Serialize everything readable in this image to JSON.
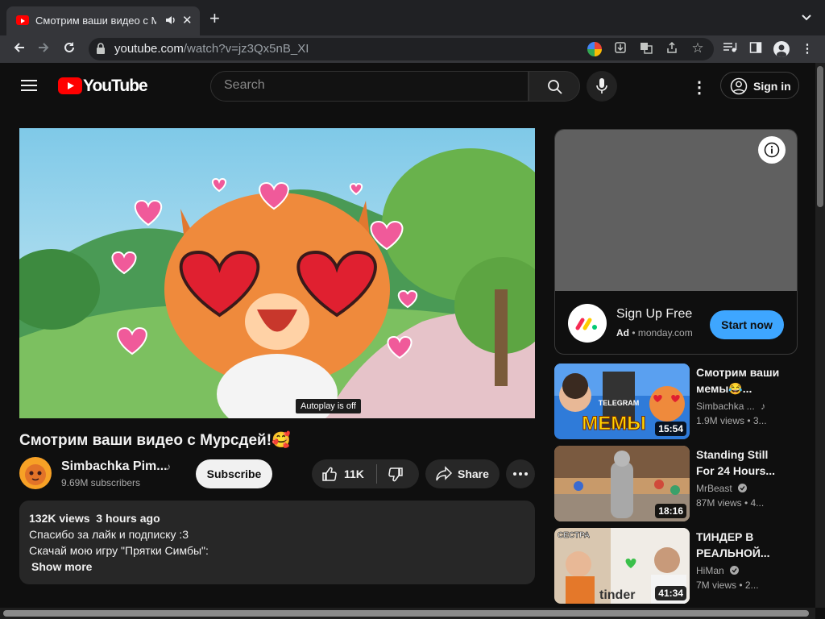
{
  "browser": {
    "tab_title": "Смотрим ваши видео с М",
    "url_host": "youtube.com",
    "url_path": "/watch?v=jz3Qx5nB_XI"
  },
  "header": {
    "logo_text": "YouTube",
    "search_placeholder": "Search",
    "signin_label": "Sign in"
  },
  "player": {
    "tooltip": "Autoplay is off"
  },
  "video": {
    "title": "Смотрим ваши видео с Мурсдей!🥰",
    "channel": "Simbachka Pim...",
    "subscribers": "9.69M subscribers",
    "subscribe_label": "Subscribe",
    "likes": "11K",
    "share_label": "Share"
  },
  "description": {
    "stats": "132K views  3 hours ago",
    "line1": "Спасибо за лайк и подписку :3",
    "line2": "Скачай мою игру \"Прятки Симбы\":",
    "show_more": "Show more"
  },
  "ad": {
    "title": "Sign Up Free",
    "badge": "Ad",
    "domain": "monday.com",
    "cta": "Start now"
  },
  "recommendations": [
    {
      "title": "Смотрим ваши мемы😂...",
      "channel": "Simbachka ...",
      "meta": "1.9M views  • 3...",
      "duration": "15:54"
    },
    {
      "title": "Standing Still For 24 Hours...",
      "channel": "MrBeast",
      "meta": "87M views  • 4...",
      "duration": "18:16"
    },
    {
      "title": "ТИНДЕР В РЕАЛЬНОЙ...",
      "channel": "HiMan",
      "meta": "7M views  • 2...",
      "duration": "41:34"
    }
  ],
  "thumb_labels": {
    "rec1_big": "МЕМЫ",
    "rec1_small": "TELEGRAM",
    "rec3_top": "СЕСТРА",
    "rec3_brand": "tinder"
  },
  "colors": {
    "accent_red": "#ff0000",
    "start_now_blue": "#3ea6ff"
  }
}
